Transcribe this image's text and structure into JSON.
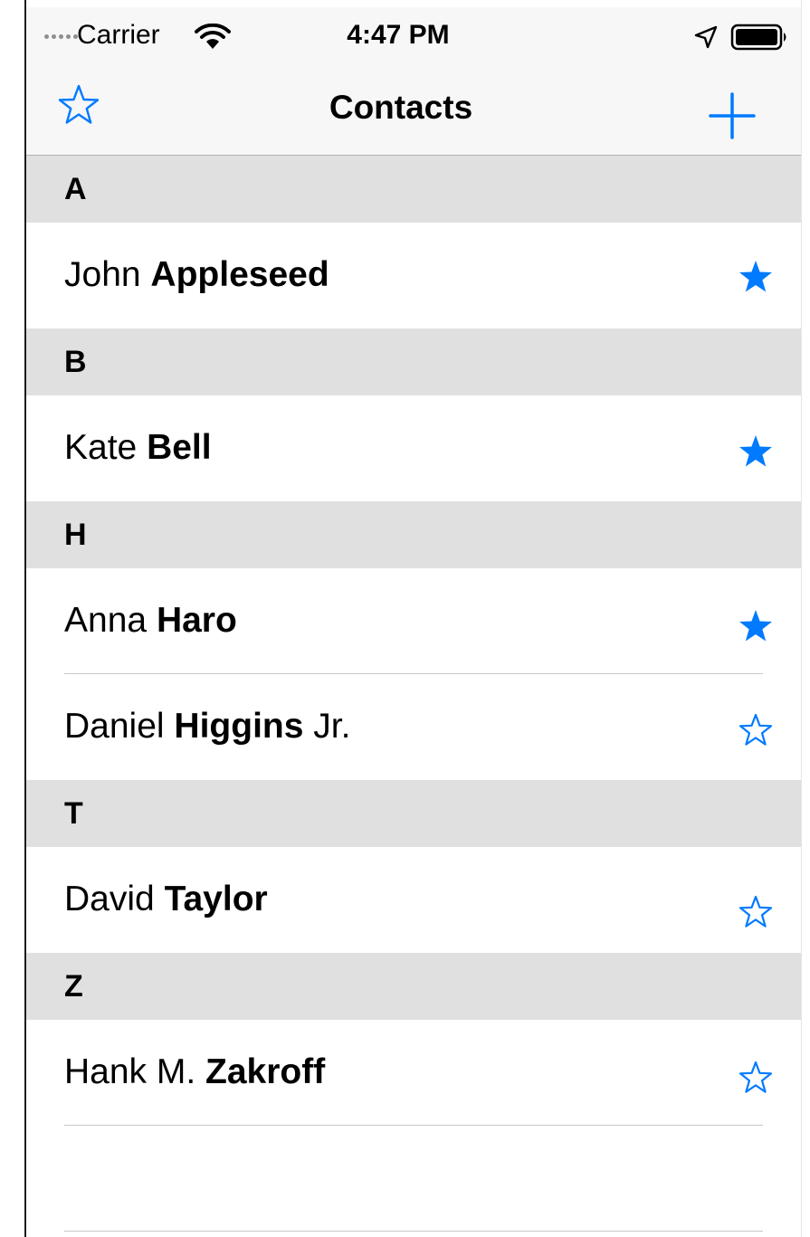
{
  "status_bar": {
    "carrier": "Carrier",
    "time": "4:47 PM",
    "icons": [
      "signal-dots-icon",
      "wifi-icon",
      "location-arrow-icon",
      "battery-icon"
    ]
  },
  "nav_bar": {
    "title": "Contacts",
    "left_icon": "star-outline-icon",
    "right_icon": "plus-icon"
  },
  "colors": {
    "accent": "#007aff",
    "section_header_bg": "#e0e0e0",
    "bar_bg": "#f7f7f7",
    "separator": "#c8c7cc"
  },
  "sections": [
    {
      "letter": "A",
      "contacts": [
        {
          "first": "John",
          "last": "Appleseed",
          "suffix": "",
          "favorite": true
        }
      ]
    },
    {
      "letter": "B",
      "contacts": [
        {
          "first": "Kate",
          "last": "Bell",
          "suffix": "",
          "favorite": true
        }
      ]
    },
    {
      "letter": "H",
      "contacts": [
        {
          "first": "Anna",
          "last": "Haro",
          "suffix": "",
          "favorite": true
        },
        {
          "first": "Daniel",
          "last": "Higgins",
          "suffix": "Jr.",
          "favorite": false
        }
      ]
    },
    {
      "letter": "T",
      "contacts": [
        {
          "first": "David",
          "last": "Taylor",
          "suffix": "",
          "favorite": false
        }
      ]
    },
    {
      "letter": "Z",
      "contacts": [
        {
          "first": "Hank M.",
          "last": "Zakroff",
          "suffix": "",
          "favorite": false
        }
      ]
    }
  ]
}
